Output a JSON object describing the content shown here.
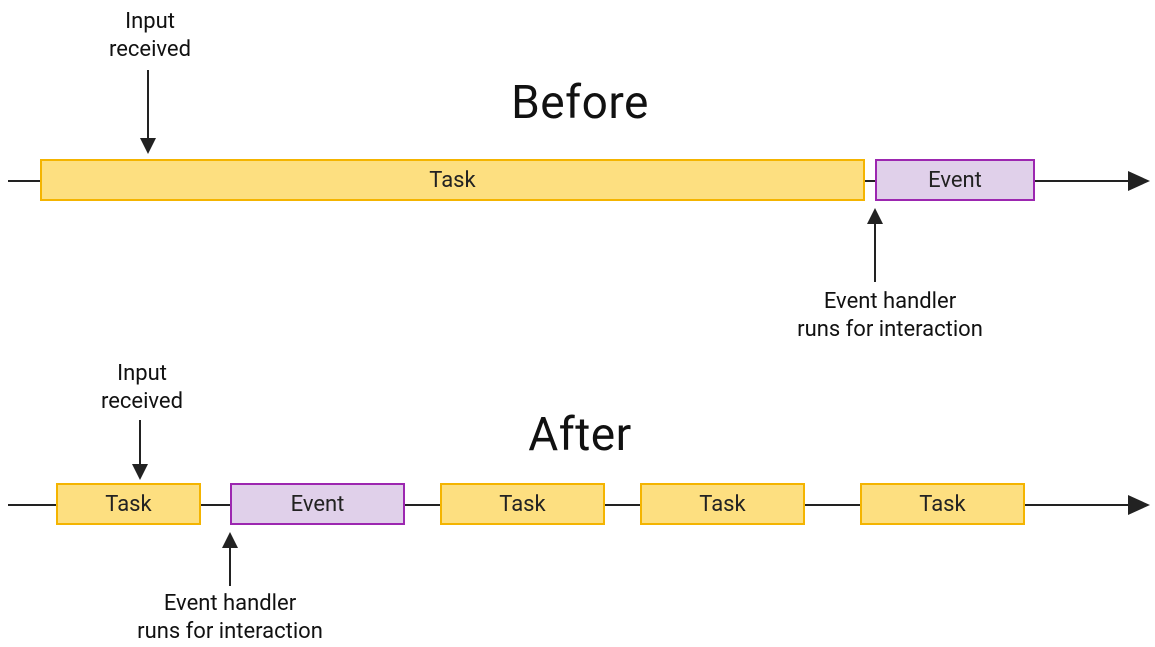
{
  "before": {
    "title": "Before",
    "input_label_line1": "Input",
    "input_label_line2": "received",
    "task_label": "Task",
    "event_label": "Event",
    "handler_label_line1": "Event handler",
    "handler_label_line2": "runs for interaction"
  },
  "after": {
    "title": "After",
    "input_label_line1": "Input",
    "input_label_line2": "received",
    "event_label": "Event",
    "task1_label": "Task",
    "task2_label": "Task",
    "task3_label": "Task",
    "task4_label": "Task",
    "handler_label_line1": "Event handler",
    "handler_label_line2": "runs for interaction"
  },
  "colors": {
    "task_fill": "#fddf80",
    "task_border": "#f4b400",
    "event_fill": "#e0d0ea",
    "event_border": "#9c27b0"
  }
}
